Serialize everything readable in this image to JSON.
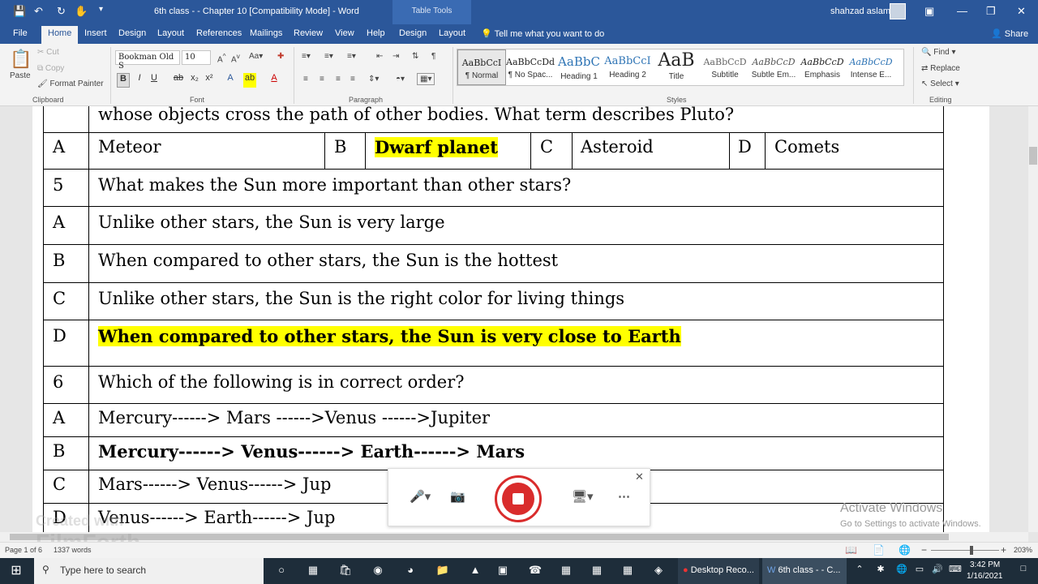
{
  "titlebar": {
    "title": "6th class -  - Chapter 10 [Compatibility Mode]  -  Word",
    "table_tools": "Table Tools",
    "user": "shahzad aslam"
  },
  "tabs": [
    "File",
    "Home",
    "Insert",
    "Design",
    "Layout",
    "References",
    "Mailings",
    "Review",
    "View",
    "Help",
    "Design",
    "Layout"
  ],
  "tell_me": "Tell me what you want to do",
  "share": "Share",
  "ribbon": {
    "clipboard": {
      "paste": "Paste",
      "cut": "Cut",
      "copy": "Copy",
      "format_painter": "Format Painter",
      "label": "Clipboard"
    },
    "font": {
      "name": "Bookman Old S",
      "size": "10",
      "label": "Font"
    },
    "paragraph": {
      "label": "Paragraph"
    },
    "styles": {
      "label": "Styles",
      "items": [
        {
          "preview": "AaBbCcI",
          "name": "¶ Normal"
        },
        {
          "preview": "AaBbCcDd",
          "name": "¶ No Spac..."
        },
        {
          "preview": "AaBbC",
          "name": "Heading 1"
        },
        {
          "preview": "AaBbCcI",
          "name": "Heading 2"
        },
        {
          "preview": "AaB",
          "name": "Title"
        },
        {
          "preview": "AaBbCcD",
          "name": "Subtitle"
        },
        {
          "preview": "AaBbCcD",
          "name": "Subtle Em..."
        },
        {
          "preview": "AaBbCcD",
          "name": "Emphasis"
        },
        {
          "preview": "AaBbCcD",
          "name": "Intense E..."
        }
      ]
    },
    "editing": {
      "find": "Find",
      "replace": "Replace",
      "select": "Select",
      "label": "Editing"
    }
  },
  "document": {
    "top_line": "whose objects cross the path of other bodies. What term describes Pluto?",
    "q4_options": {
      "A": "A",
      "a": "Meteor",
      "B": "B",
      "b": "Dwarf planet",
      "C": "C",
      "c": "Asteroid",
      "D": "D",
      "d": "Comets"
    },
    "q5": {
      "num": "5",
      "text": "What makes the Sun more important than other stars?"
    },
    "q5_opts": [
      {
        "letter": "A",
        "text": "Unlike other stars, the Sun is very large"
      },
      {
        "letter": "B",
        "text": "When compared to other stars, the Sun is the hottest"
      },
      {
        "letter": "C",
        "text": "Unlike other stars, the Sun is the right color for living things"
      },
      {
        "letter": "D",
        "text": "When compared to other stars, the Sun is very close to Earth"
      }
    ],
    "q6": {
      "num": "6",
      "text": "Which of the following is in correct order?"
    },
    "q6_opts": [
      {
        "letter": "A",
        "text": "Mercury------> Mars ------>Venus ------>Jupiter"
      },
      {
        "letter": "B",
        "text": "Mercury------> Venus------> Earth------> Mars"
      },
      {
        "letter": "C",
        "text": "Mars------> Venus------> Jup"
      },
      {
        "letter": "D",
        "text": "Venus------> Earth------> Jup"
      }
    ]
  },
  "status": {
    "page": "Page 1 of 6",
    "words": "1337 words",
    "zoom": "203%"
  },
  "activate": {
    "line1": "Activate Windows",
    "line2": "Go to Settings to activate Windows."
  },
  "watermark": {
    "line1": "Created with",
    "line2": "FilmForth"
  },
  "taskbar": {
    "search": "Type here to search",
    "app1": "Desktop Reco...",
    "app2": "6th class - - C...",
    "time": "3:42 PM",
    "date": "1/16/2021"
  }
}
